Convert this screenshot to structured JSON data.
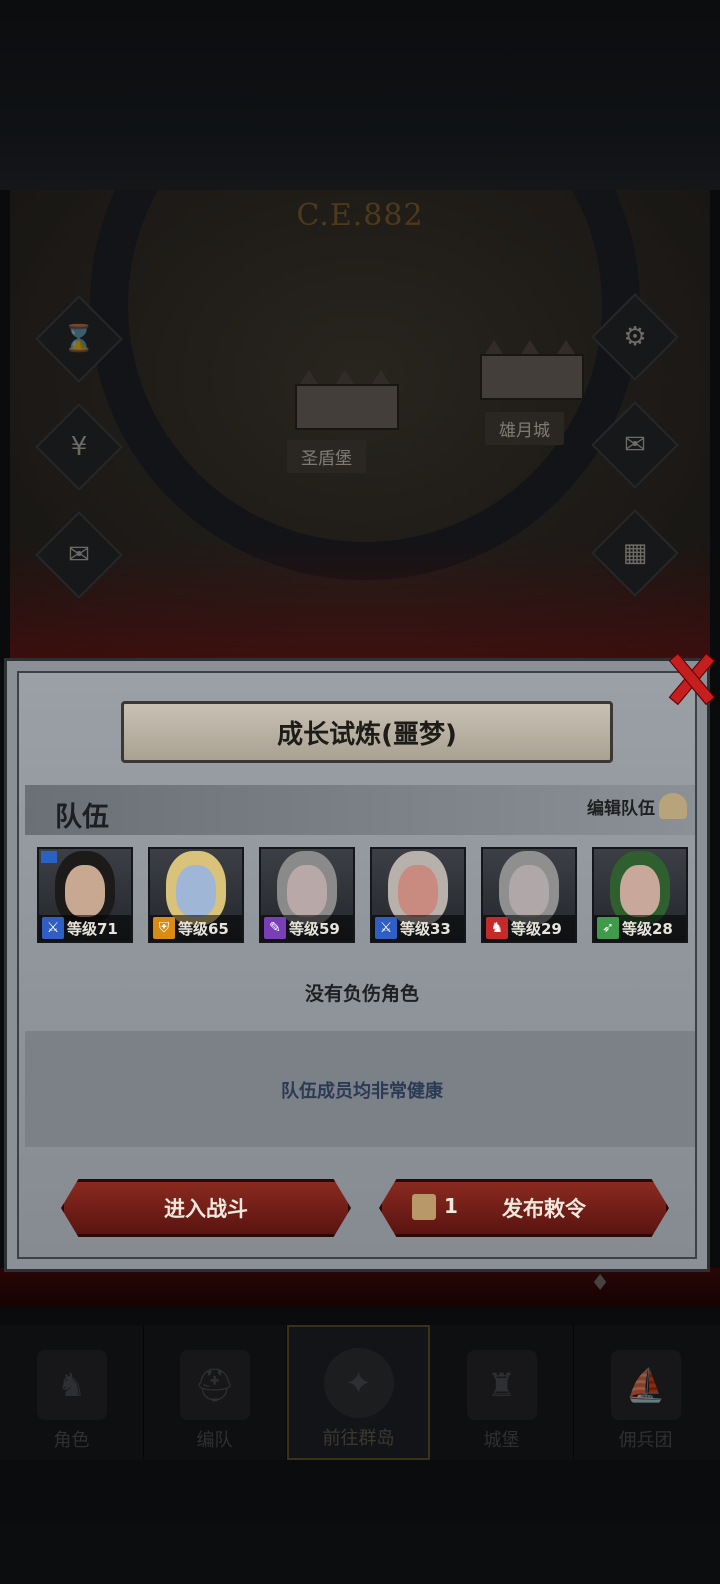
{
  "map": {
    "era": "C.E.882",
    "castles": [
      {
        "name": "圣盾堡"
      },
      {
        "name": "雄月城"
      }
    ]
  },
  "dialog": {
    "title": "成长试炼(噩梦)",
    "team_label": "队伍",
    "edit_team_label": "编辑队伍",
    "members": [
      {
        "level_text": "等级71",
        "class_icon": "sword-icon",
        "class_color": "#2f5fc4",
        "face_color": "#c8a890",
        "hair_color": "#1d1a1a",
        "leader": true
      },
      {
        "level_text": "等级65",
        "class_icon": "shield-icon",
        "class_color": "#d98b13",
        "face_color": "#9fb6d6",
        "hair_color": "#d9c27a",
        "leader": false
      },
      {
        "level_text": "等级59",
        "class_icon": "staff-icon",
        "class_color": "#7a3fb8",
        "face_color": "#b8a8a8",
        "hair_color": "#8a8a8a",
        "leader": false
      },
      {
        "level_text": "等级33",
        "class_icon": "sword-icon",
        "class_color": "#2f5fc4",
        "face_color": "#c98a80",
        "hair_color": "#b8b0aa",
        "leader": false
      },
      {
        "level_text": "等级29",
        "class_icon": "horse-icon",
        "class_color": "#c42a2a",
        "face_color": "#b0a8a8",
        "hair_color": "#8f8f8f",
        "leader": false
      },
      {
        "level_text": "等级28",
        "class_icon": "bow-icon",
        "class_color": "#3f9a4a",
        "face_color": "#c8a89a",
        "hair_color": "#2f5f2f",
        "leader": false
      }
    ],
    "no_injured_text": "没有负伤角色",
    "health_text": "队伍成员均非常健康",
    "enter_battle_label": "进入战斗",
    "decree_count": "1",
    "decree_label": "发布敕令"
  },
  "nav": {
    "items": [
      {
        "label": "角色",
        "icon": "knight-icon",
        "active": false
      },
      {
        "label": "编队",
        "icon": "helmet-icon",
        "active": false
      },
      {
        "label": "前往群岛",
        "icon": "compass-icon",
        "active": true
      },
      {
        "label": "城堡",
        "icon": "castle-icon",
        "active": false
      },
      {
        "label": "佣兵团",
        "icon": "ship-icon",
        "active": false
      }
    ]
  },
  "colors": {
    "accent_red": "#c41e1e",
    "dialog_bg": "#8a9096",
    "title_plate": "#c8c1b3"
  }
}
